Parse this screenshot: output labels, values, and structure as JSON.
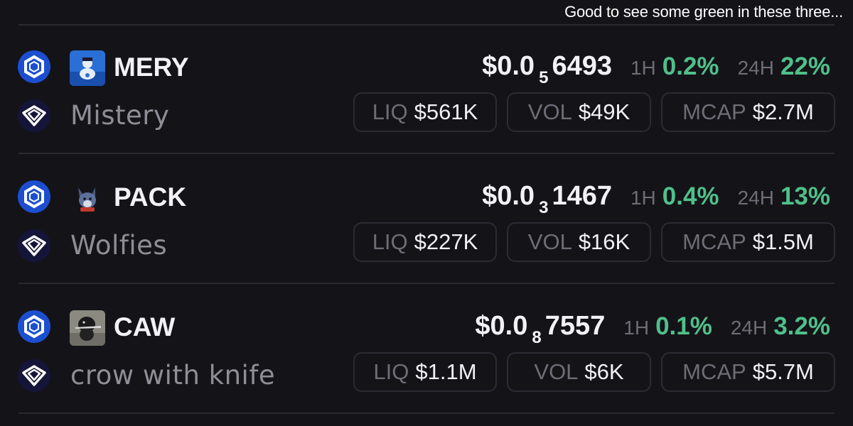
{
  "caption": "Good to see some green in these three...",
  "colors": {
    "background": "#141318",
    "positive": "#4fc08a",
    "chain_blue": "#1c4fd0"
  },
  "tokens": [
    {
      "ticker": "MERY",
      "name": "Mistery",
      "price_prefix": "$0.0",
      "price_zeros": "5",
      "price_digits": "6493",
      "h1_label": "1H",
      "h1_change": "0.2%",
      "h24_label": "24H",
      "h24_change": "22%",
      "liq_label": "LIQ",
      "liq": "$561K",
      "vol_label": "VOL",
      "vol": "$49K",
      "mcap_label": "MCAP",
      "mcap": "$2.7M",
      "chain_icon": "base-chain-icon",
      "dex_icon": "dex-icon",
      "logo": "mery-token-logo"
    },
    {
      "ticker": "PACK",
      "name": "Wolfies",
      "price_prefix": "$0.0",
      "price_zeros": "3",
      "price_digits": "1467",
      "h1_label": "1H",
      "h1_change": "0.4%",
      "h24_label": "24H",
      "h24_change": "13%",
      "liq_label": "LIQ",
      "liq": "$227K",
      "vol_label": "VOL",
      "vol": "$16K",
      "mcap_label": "MCAP",
      "mcap": "$1.5M",
      "chain_icon": "base-chain-icon",
      "dex_icon": "dex-icon",
      "logo": "wolf-token-logo"
    },
    {
      "ticker": "CAW",
      "name": "crow with knife",
      "price_prefix": "$0.0",
      "price_zeros": "8",
      "price_digits": "7557",
      "h1_label": "1H",
      "h1_change": "0.1%",
      "h24_label": "24H",
      "h24_change": "3.2%",
      "liq_label": "LIQ",
      "liq": "$1.1M",
      "vol_label": "VOL",
      "vol": "$6K",
      "mcap_label": "MCAP",
      "mcap": "$5.7M",
      "chain_icon": "base-chain-icon",
      "dex_icon": "dex-icon",
      "logo": "crow-token-logo"
    }
  ]
}
